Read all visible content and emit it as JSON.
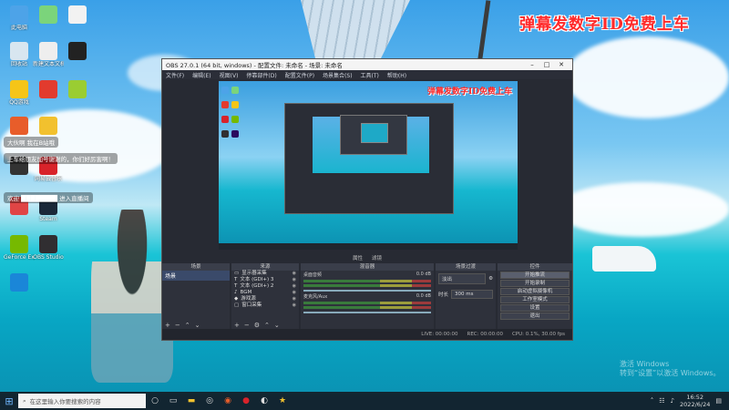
{
  "banner": "弹幕发数字ID免费上车",
  "desktop_icons": [
    {
      "label": "此电脑",
      "color": "#4da3e8"
    },
    {
      "label": "",
      "color": "#7bd47b"
    },
    {
      "label": "",
      "color": "#f2f2f2"
    },
    {
      "label": "回收站",
      "color": "#d8e6f0"
    },
    {
      "label": "新建文本文档",
      "color": "#eee"
    },
    {
      "label": "",
      "color": "#222"
    },
    {
      "label": "QQ游戏",
      "color": "#f5c518"
    },
    {
      "label": "",
      "color": "#e23b2e"
    },
    {
      "label": "",
      "color": "#9acd32"
    },
    {
      "label": "",
      "color": "#e85d2a"
    },
    {
      "label": "",
      "color": "#f2c12e"
    },
    {
      "label": "",
      "color": "#333"
    },
    {
      "label": "网易云音乐",
      "color": "#d8232a"
    },
    {
      "label": "",
      "color": "#e04545"
    },
    {
      "label": "Steam",
      "color": "#1b2838"
    },
    {
      "label": "GeForce Experience",
      "color": "#76b900"
    },
    {
      "label": "OBS Studio",
      "color": "#302e31"
    },
    {
      "label": "",
      "color": "#1a86d8"
    },
    {
      "label": "Adobe Premiere",
      "color": "#2a0a5e"
    }
  ],
  "danmaku": [
    {
      "text": "大伙啊 我在B站哦"
    },
    {
      "text": "上车给朋友加号谢谢的，你们好厉害啊！"
    },
    {
      "text": "欢迎 ████████ 进入直播间"
    }
  ],
  "obs": {
    "title": "OBS 27.0.1 (64 bit, windows) - 配置文件: 未命名 - 场景: 未命名",
    "menu": [
      "文件(F)",
      "编辑(E)",
      "视图(V)",
      "停靠部件(D)",
      "配置文件(P)",
      "场景集合(S)",
      "工具(T)",
      "帮助(H)"
    ],
    "midbar": [
      "属性",
      "滤镜"
    ],
    "docks": {
      "scenes": {
        "title": "场景",
        "items": [
          "场景"
        ]
      },
      "sources": {
        "title": "来源",
        "items": [
          {
            "label": "显示器采集",
            "icon": "monitor-icon"
          },
          {
            "label": "文本 (GDI+) 3",
            "icon": "text-icon"
          },
          {
            "label": "文本 (GDI+) 2",
            "icon": "text-icon"
          },
          {
            "label": "BGM",
            "icon": "audio-icon"
          },
          {
            "label": "游戏源",
            "icon": "game-icon"
          },
          {
            "label": "窗口采集",
            "icon": "window-icon"
          }
        ]
      },
      "mixer": {
        "title": "混音器",
        "channels": [
          {
            "label": "桌面音频",
            "db": "0.0 dB"
          },
          {
            "label": "麦克风/Aux",
            "db": "0.0 dB"
          }
        ]
      },
      "transitions": {
        "title": "场景过渡",
        "type": "淡出",
        "duration_label": "时长",
        "duration": "300 ms"
      },
      "controls": {
        "title": "控件",
        "buttons": [
          "开始推流",
          "开始录制",
          "启动虚拟摄像机",
          "工作室模式",
          "设置",
          "退出"
        ]
      }
    },
    "status": [
      "LIVE: 00:00:00",
      "REC: 00:00:00",
      "CPU: 0.1%, 30.00 fps"
    ]
  },
  "watermark": {
    "line1": "激活 Windows",
    "line2": "转到“设置”以激活 Windows。"
  },
  "taskbar": {
    "search_placeholder": "在这里输入你要搜索的内容",
    "time": "16:52",
    "date": "2022/6/24"
  }
}
